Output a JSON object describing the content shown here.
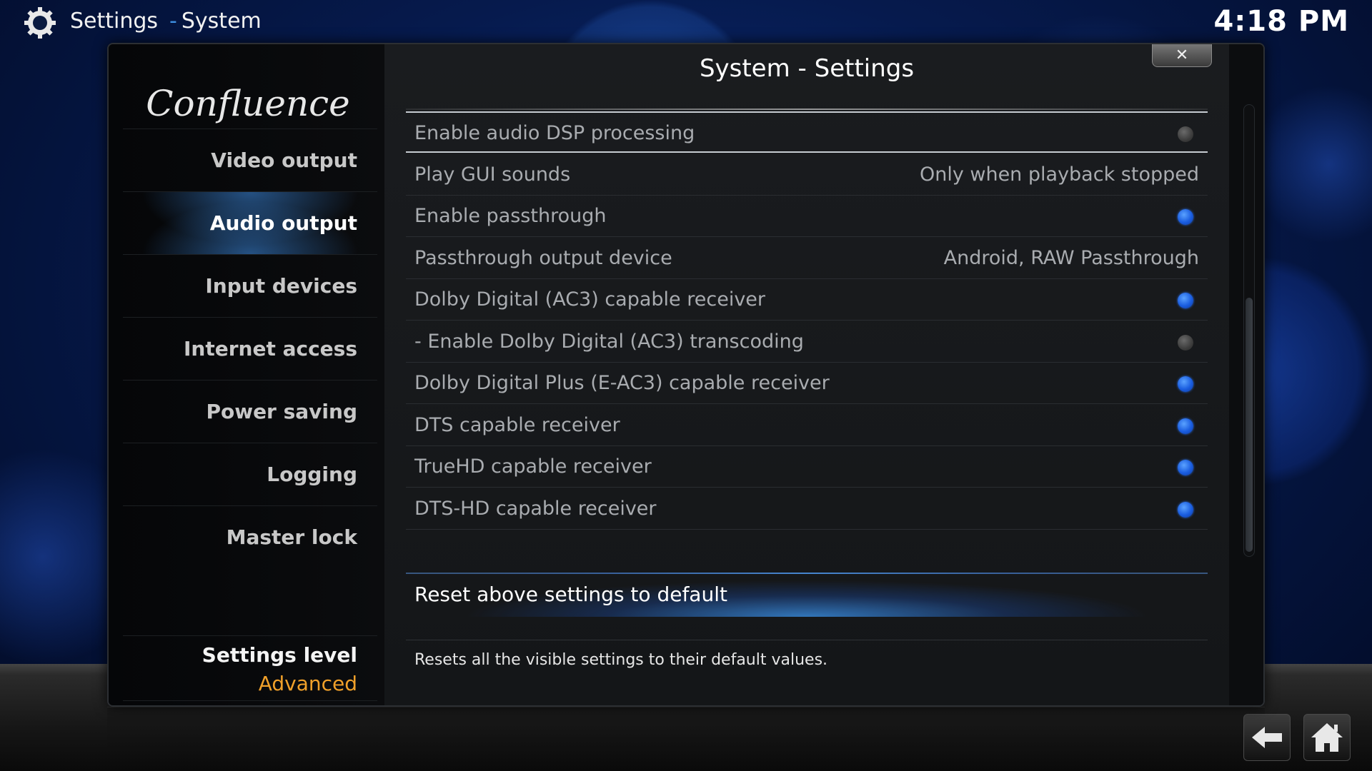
{
  "header": {
    "section": "Settings",
    "separator": "-",
    "subsection": "System",
    "clock": "4:18 PM",
    "icon": "gear-icon"
  },
  "dialog": {
    "title": "System - Settings",
    "close_label": "✕",
    "logo_text": "Confluence"
  },
  "sidebar": {
    "items": [
      {
        "label": "Video output"
      },
      {
        "label": "Audio output",
        "active": true
      },
      {
        "label": "Input devices"
      },
      {
        "label": "Internet access"
      },
      {
        "label": "Power saving"
      },
      {
        "label": "Logging"
      },
      {
        "label": "Master lock"
      }
    ],
    "settings_level_label": "Settings level",
    "settings_level_value": "Advanced"
  },
  "settings": [
    {
      "label": "Enable audio DSP processing",
      "type": "toggle",
      "on": false
    },
    {
      "label": "Play GUI sounds",
      "type": "value",
      "value": "Only when playback stopped"
    },
    {
      "label": "Enable passthrough",
      "type": "toggle",
      "on": true
    },
    {
      "label": "Passthrough output device",
      "type": "value",
      "value": "Android, RAW Passthrough"
    },
    {
      "label": "Dolby Digital (AC3) capable receiver",
      "type": "toggle",
      "on": true
    },
    {
      "label": "- Enable Dolby Digital (AC3) transcoding",
      "type": "toggle",
      "on": false
    },
    {
      "label": "Dolby Digital Plus (E-AC3) capable receiver",
      "type": "toggle",
      "on": true
    },
    {
      "label": "DTS capable receiver",
      "type": "toggle",
      "on": true
    },
    {
      "label": "TrueHD capable receiver",
      "type": "toggle",
      "on": true
    },
    {
      "label": "DTS-HD capable receiver",
      "type": "toggle",
      "on": true
    }
  ],
  "reset": {
    "label": "Reset above settings to default",
    "description": "Resets all the visible settings to their default values."
  },
  "colors": {
    "accent": "#3d8fe0",
    "level_value": "#f0a02a",
    "toggle_on": "#1a5de0",
    "toggle_off": "#3d3d3d"
  },
  "nav": {
    "back_icon": "back-arrow-icon",
    "home_icon": "home-icon"
  }
}
